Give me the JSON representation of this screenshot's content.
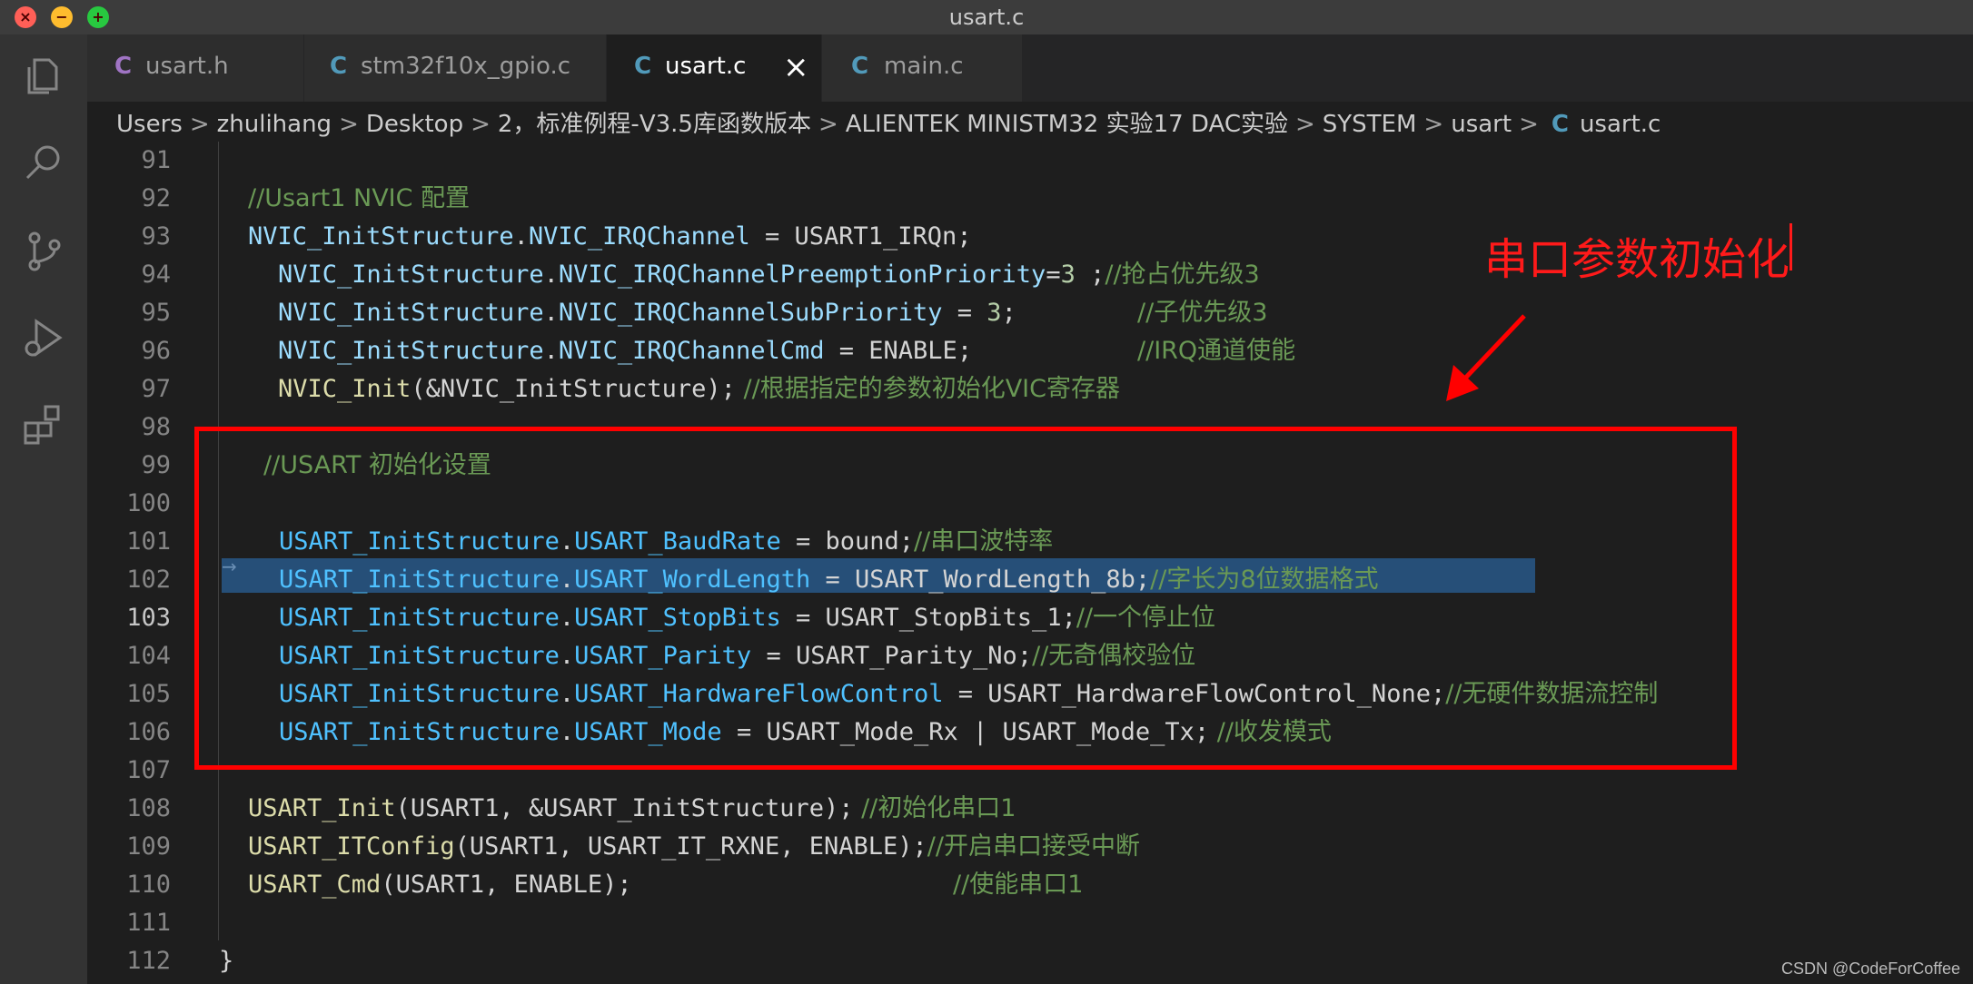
{
  "window": {
    "title": "usart.c"
  },
  "tabs": [
    {
      "label": "usart.h",
      "icon": "C",
      "icon_color": "#a074c4",
      "active": false
    },
    {
      "label": "stm32f10x_gpio.c",
      "icon": "C",
      "icon_color": "#519aba",
      "active": false
    },
    {
      "label": "usart.c",
      "icon": "C",
      "icon_color": "#519aba",
      "active": true,
      "close": "×"
    },
    {
      "label": "main.c",
      "icon": "C",
      "icon_color": "#519aba",
      "active": false
    }
  ],
  "breadcrumb": {
    "items": [
      "Users",
      "zhulihang",
      "Desktop",
      "2，标准例程-V3.5库函数版本",
      "ALIENTEK MINISTM32 实验17 DAC实验",
      "SYSTEM",
      "usart"
    ],
    "separator": ">",
    "file_icon": "C",
    "file": "usart.c"
  },
  "activity_bar": [
    "files-icon",
    "search-icon",
    "source-control-icon",
    "run-debug-icon",
    "extensions-icon"
  ],
  "editor": {
    "current_line": "103",
    "lines": [
      {
        "n": "91"
      },
      {
        "n": "92",
        "comment": "//Usart1 NVIC 配置"
      },
      {
        "n": "93",
        "a": "NVIC_InitStructure",
        "b": "NVIC_IRQChannel",
        "eq": " = ",
        "val": "USART1_IRQn",
        "end": ";"
      },
      {
        "n": "94",
        "a": "NVIC_InitStructure",
        "b": "NVIC_IRQChannelPreemptionPriority",
        "eq": "=",
        "num": "3",
        "end": " ;",
        "comment": "//抢占优先级3"
      },
      {
        "n": "95",
        "a": "NVIC_InitStructure",
        "b": "NVIC_IRQChannelSubPriority",
        "eq": " = ",
        "num": "3",
        "end": ";",
        "comment": "//子优先级3"
      },
      {
        "n": "96",
        "a": "NVIC_InitStructure",
        "b": "NVIC_IRQChannelCmd",
        "eq": " = ",
        "val": "ENABLE",
        "end": ";",
        "comment": "//IRQ通道使能"
      },
      {
        "n": "97",
        "fn": "NVIC_Init",
        "args": "(&NVIC_InitStructure);",
        "comment": " //根据指定的参数初始化VIC寄存器"
      },
      {
        "n": "98"
      },
      {
        "n": "99",
        "comment": "//USART 初始化设置"
      },
      {
        "n": "100"
      },
      {
        "n": "101",
        "a": "USART_InitStructure",
        "b": "USART_BaudRate",
        "eq": " = ",
        "val": "bound",
        "end": ";",
        "comment": "//串口波特率"
      },
      {
        "n": "102",
        "a": "USART_InitStructure",
        "b": "USART_WordLength",
        "eq": " = ",
        "val": "USART_WordLength_8b",
        "end": ";",
        "comment": "//字长为8位数据格式"
      },
      {
        "n": "103",
        "a": "USART_InitStructure",
        "b": "USART_StopBits",
        "eq": " = ",
        "val": "USART_StopBits_1",
        "end": ";",
        "comment": "//一个停止位"
      },
      {
        "n": "104",
        "a": "USART_InitStructure",
        "b": "USART_Parity",
        "eq": " = ",
        "val": "USART_Parity_No",
        "end": ";",
        "comment": "//无奇偶校验位"
      },
      {
        "n": "105",
        "a": "USART_InitStructure",
        "b": "USART_HardwareFlowControl",
        "eq": " = ",
        "val": "USART_HardwareFlowControl_None",
        "end": ";",
        "comment": "//无硬件数据流控制"
      },
      {
        "n": "106",
        "a": "USART_InitStructure",
        "b": "USART_Mode",
        "eq": " = ",
        "val": "USART_Mode_Rx | USART_Mode_Tx",
        "end": ";",
        "comment": " //收发模式"
      },
      {
        "n": "107"
      },
      {
        "n": "108",
        "fn": "USART_Init",
        "args": "(USART1, &USART_InitStructure);",
        "comment": " //初始化串口1"
      },
      {
        "n": "109",
        "fn": "USART_ITConfig",
        "args": "(USART1, USART_IT_RXNE, ENABLE);",
        "comment": "//开启串口接受中断"
      },
      {
        "n": "110",
        "fn": "USART_Cmd",
        "args": "(USART1, ENABLE);",
        "comment": "//使能串口1"
      },
      {
        "n": "111"
      },
      {
        "n": "112",
        "brace": "}"
      }
    ]
  },
  "annotation": {
    "text": "串口参数初始化",
    "color": "#ff0000"
  },
  "watermark": "CSDN @CodeForCoffee"
}
